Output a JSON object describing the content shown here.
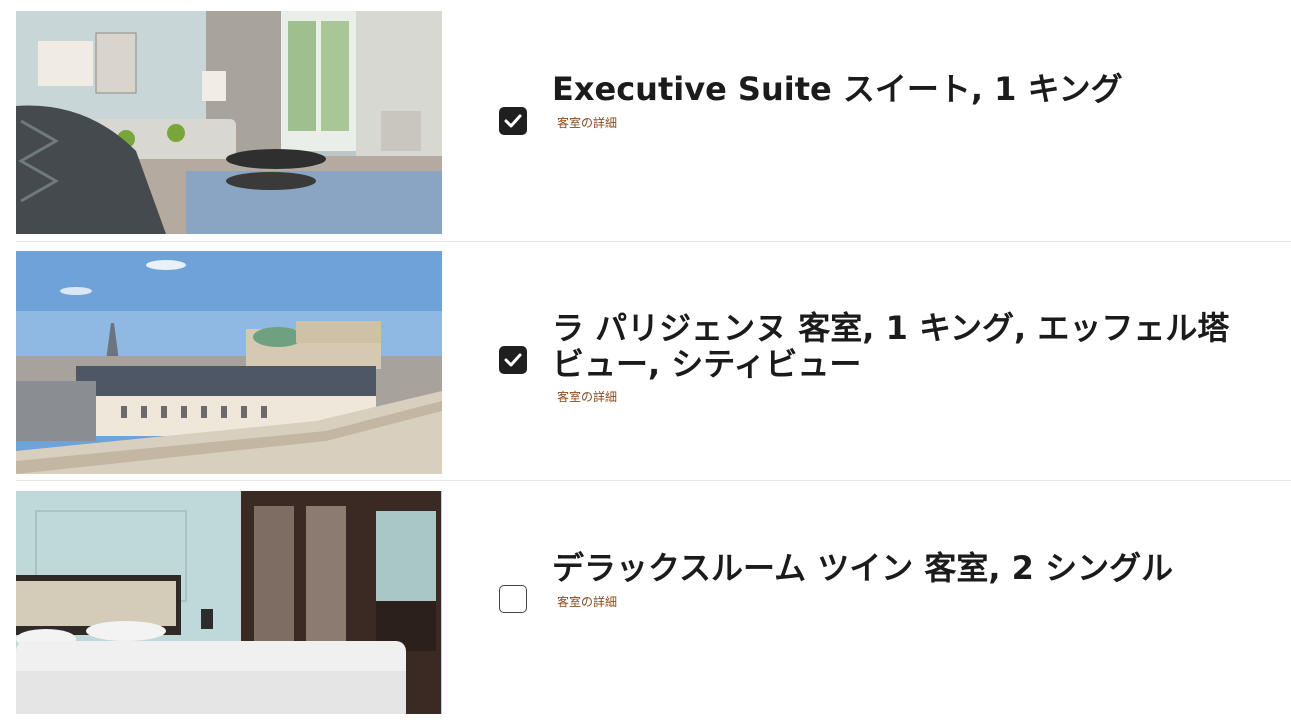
{
  "rooms": [
    {
      "title": "Executive Suite スイート, 1 キング",
      "details_link": "客室の詳細",
      "checked": true,
      "image": "executive-suite-living-room-photo"
    },
    {
      "title": "ラ パリジェンヌ 客室, 1 キング, エッフェル塔ビュー, シティビュー",
      "details_link": "客室の詳細",
      "checked": true,
      "image": "paris-rooftop-eiffel-view-photo"
    },
    {
      "title": "デラックスルーム ツイン 客室, 2 シングル",
      "details_link": "客室の詳細",
      "checked": false,
      "image": "deluxe-twin-bedroom-photo"
    }
  ],
  "colors": {
    "checkbox_checked": "#1f1f1f",
    "link": "#8a4a1c",
    "divider": "#e6e6e6"
  }
}
